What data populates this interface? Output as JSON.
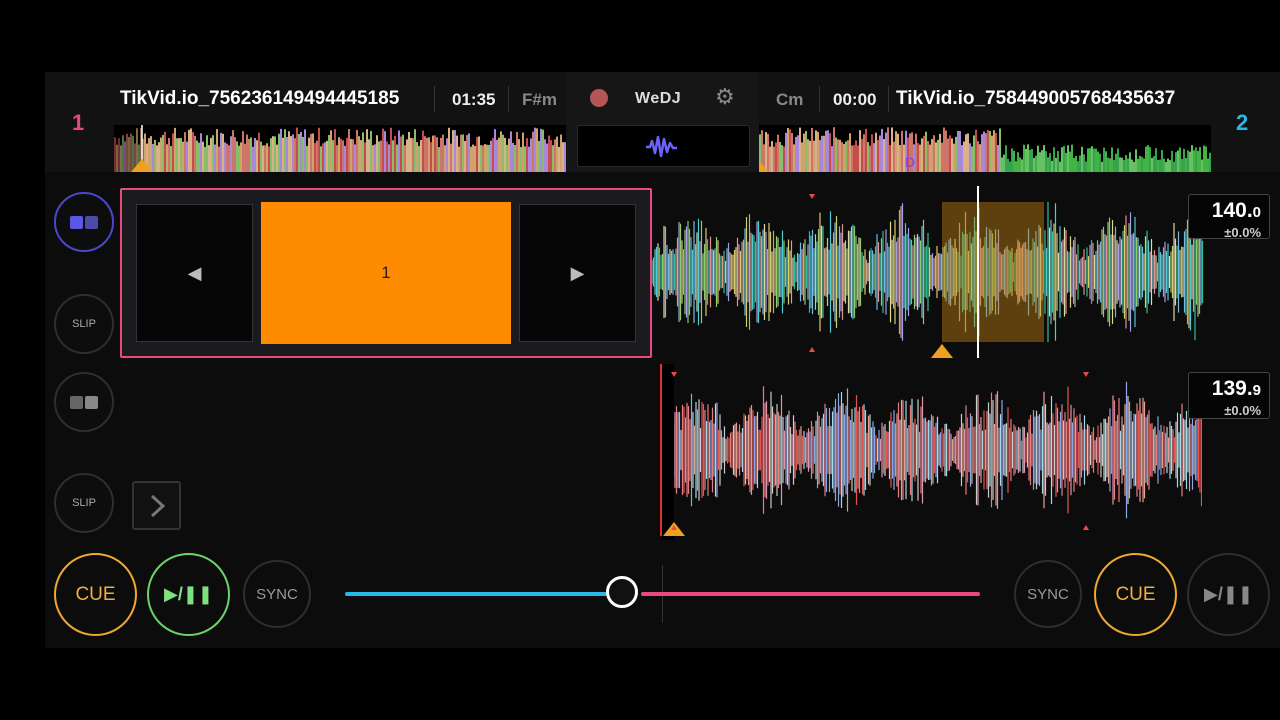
{
  "deck1": {
    "number": "1",
    "title": "TikVid.io_756236149494445185",
    "time": "01:35",
    "key": "F#m",
    "bpm": "140.",
    "bpm_decimal": "0",
    "pitch": "±0.0%",
    "slip_label": "SLIP",
    "cue_label": "CUE",
    "play_label": "▶/❚❚",
    "sync_label": "SYNC"
  },
  "deck2": {
    "number": "2",
    "title": "TikVid.io_758449005768435637",
    "time": "00:00",
    "key": "Cm",
    "bpm": "139.",
    "bpm_decimal": "9",
    "pitch": "±0.0%",
    "slip_label": "SLIP",
    "cue_label": "CUE",
    "play_label": "▶/❚❚",
    "sync_label": "SYNC",
    "overview_marker": "D"
  },
  "center": {
    "brand": "WeDJ"
  },
  "pads": {
    "prev_glyph": "◀",
    "main_label": "1",
    "next_glyph": "▶"
  },
  "crossfader": {
    "position_fraction": 0.45
  },
  "colors": {
    "deck1_accent": "#e84a7f",
    "deck2_accent": "#29b7e8",
    "cue": "#f0a830",
    "play_active": "#6bd36b",
    "pad_active": "#ff8c00"
  },
  "icons": {
    "record": "record-icon",
    "settings": "gear-icon",
    "waveform": "waveform-icon",
    "pad_mode": "pad-mode-icon",
    "expand": "chevron-right-icon"
  }
}
